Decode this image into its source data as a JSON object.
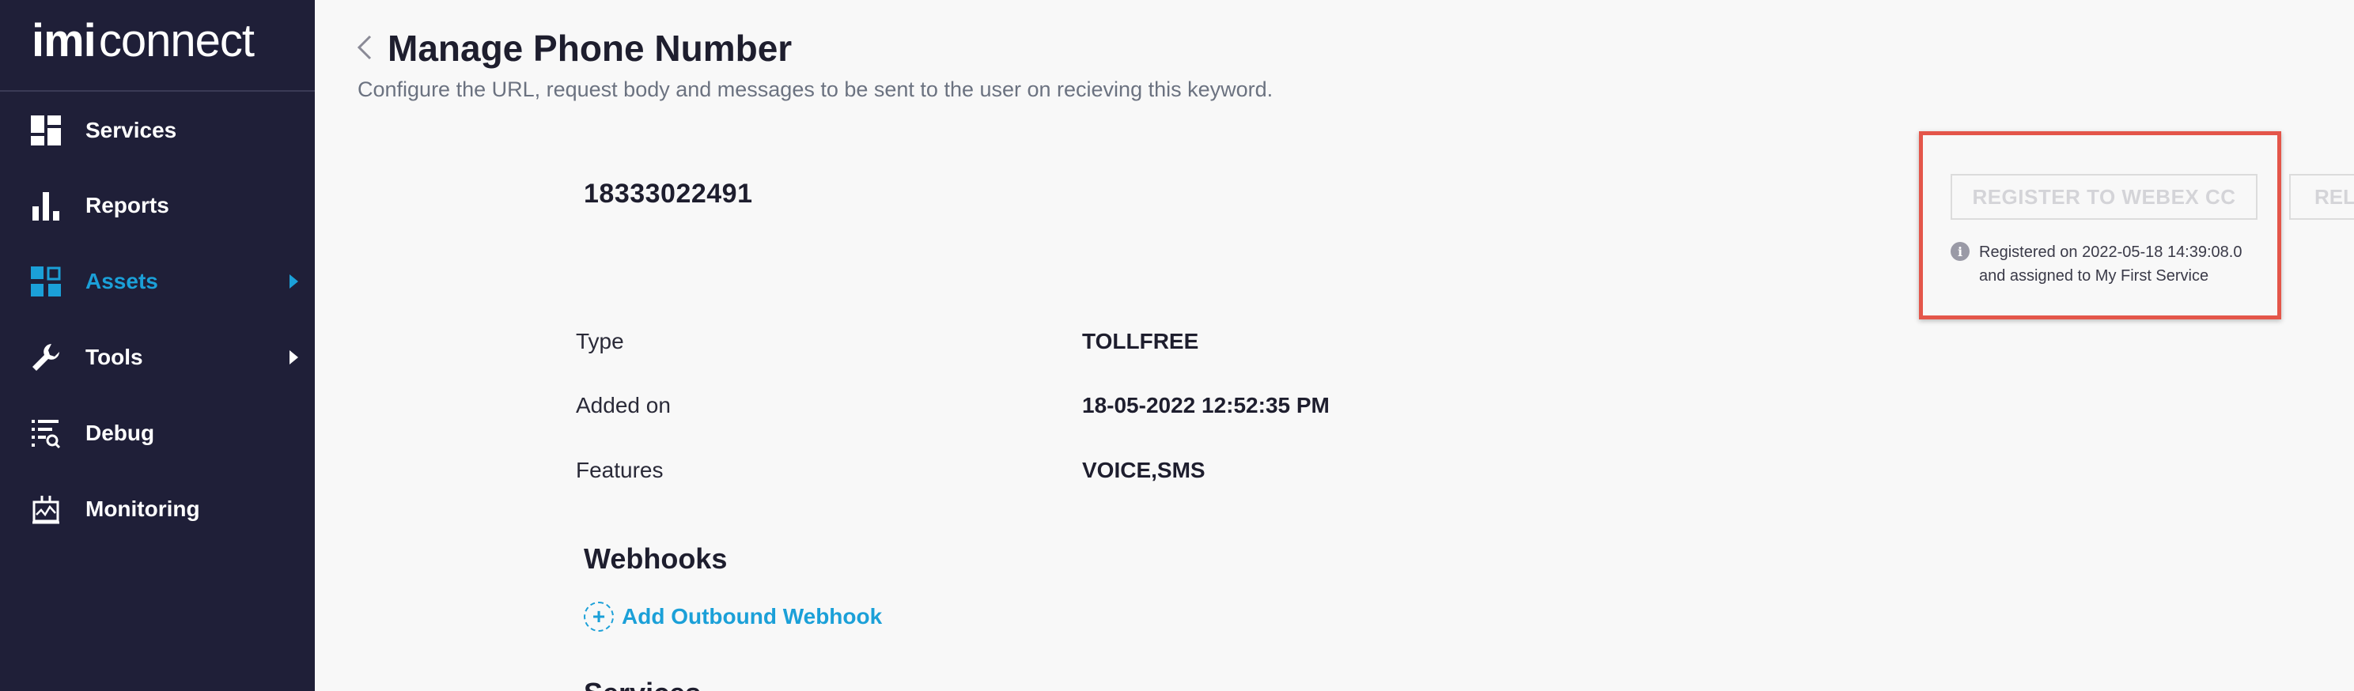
{
  "brand": {
    "part1": "imi",
    "part2": "connect"
  },
  "sidebar": {
    "items": [
      {
        "label": "Services",
        "icon": "dashboard-icon",
        "active": false
      },
      {
        "label": "Reports",
        "icon": "bar-chart-icon",
        "active": false
      },
      {
        "label": "Assets",
        "icon": "assets-grid-icon",
        "active": true
      },
      {
        "label": "Tools",
        "icon": "wrench-icon",
        "active": false
      },
      {
        "label": "Debug",
        "icon": "debug-list-icon",
        "active": false
      },
      {
        "label": "Monitoring",
        "icon": "monitoring-icon",
        "active": false
      }
    ]
  },
  "header": {
    "title": "Manage Phone Number",
    "subtitle": "Configure the URL, request body and messages to be sent to the user on recieving this keyword."
  },
  "phone": {
    "number": "18333022491",
    "details": [
      {
        "label": "Type",
        "value": "TOLLFREE"
      },
      {
        "label": "Added on",
        "value": "18-05-2022 12:52:35 PM"
      },
      {
        "label": "Features",
        "value": "VOICE,SMS"
      }
    ]
  },
  "webhooks": {
    "title": "Webhooks",
    "add_label": "Add Outbound Webhook"
  },
  "next_section": {
    "title": "Services"
  },
  "actions": {
    "register_label": "REGISTER TO WEBEX CC",
    "release_label": "RELEASE",
    "info_line1": "Registered on 2022-05-18 14:39:08.0",
    "info_line2": "and assigned to My First Service"
  },
  "colors": {
    "sidebar_bg": "#1f1f38",
    "accent": "#1ba0d8",
    "highlight": "#e4564a",
    "page_bg": "#f8f8f8"
  }
}
